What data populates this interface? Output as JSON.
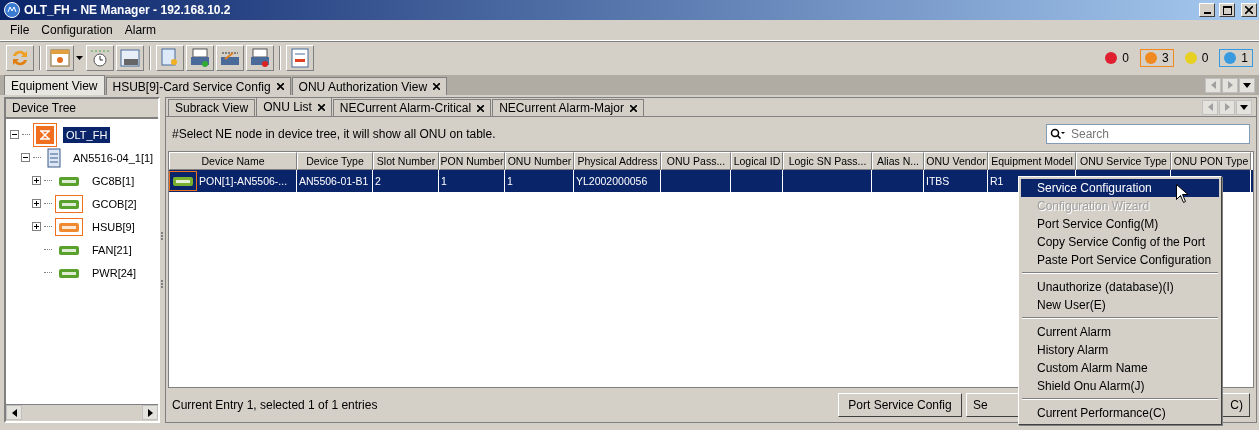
{
  "window": {
    "title": "OLT_FH - NE Manager - 192.168.10.2"
  },
  "menu_bar": [
    "File",
    "Configuration",
    "Alarm"
  ],
  "alarm_counters": [
    {
      "count": "0",
      "color": "#e02030",
      "selected": false
    },
    {
      "count": "3",
      "color": "#f08a20",
      "selected": true
    },
    {
      "count": "0",
      "color": "#e8d020",
      "selected": false
    },
    {
      "count": "1",
      "color": "#3a9ae0",
      "selected": true
    }
  ],
  "tabs": [
    {
      "label": "Equipment View",
      "selected": true,
      "closable": false
    },
    {
      "label": "HSUB[9]-Card Service Config",
      "selected": false,
      "closable": true
    },
    {
      "label": "ONU Authorization View",
      "selected": false,
      "closable": true
    }
  ],
  "device_tree": {
    "title": "Device Tree",
    "items": [
      {
        "label": "OLT_FH",
        "kind": "olt",
        "selected": true,
        "flagged": true,
        "expanded": true,
        "children": [
          {
            "label": "AN5516-04_1[1]",
            "kind": "rack",
            "selected": false,
            "flagged": false,
            "expanded": true,
            "children": [
              {
                "label": "GC8B[1]",
                "kind": "card",
                "color": "#5aa02c",
                "selected": false,
                "flagged": false,
                "expanded": false
              },
              {
                "label": "GCOB[2]",
                "kind": "card",
                "color": "#5aa02c",
                "selected": false,
                "flagged": true,
                "expanded": false
              },
              {
                "label": "HSUB[9]",
                "kind": "card",
                "color": "#f08a30",
                "selected": false,
                "flagged": true,
                "expanded": false
              },
              {
                "label": "FAN[21]",
                "kind": "card",
                "color": "#5aa02c",
                "selected": false,
                "flagged": false
              },
              {
                "label": "PWR[24]",
                "kind": "card",
                "color": "#5aa02c",
                "selected": false,
                "flagged": false
              }
            ]
          }
        ]
      }
    ]
  },
  "inner_tabs": [
    {
      "label": "Subrack View",
      "selected": false,
      "closable": false
    },
    {
      "label": "ONU List",
      "selected": true,
      "closable": true
    },
    {
      "label": "NECurrent Alarm-Critical",
      "selected": false,
      "closable": true
    },
    {
      "label": "NECurrent Alarm-Major",
      "selected": false,
      "closable": true
    }
  ],
  "hint": "#Select NE node in device tree, it will show all ONU on table.",
  "search": {
    "placeholder": "Search"
  },
  "table": {
    "columns": [
      "Device Name",
      "Device Type",
      "Slot Number",
      "PON Number",
      "ONU Number",
      "Physical Address",
      "ONU Pass...",
      "Logical ID",
      "Logic SN Pass...",
      "Alias N...",
      "ONU Vendor",
      "Equipment Model",
      "ONU Service Type",
      "ONU PON Type"
    ],
    "rows": [
      {
        "selected": true,
        "flagged": true,
        "cells": [
          "PON[1]-AN5506-...",
          "AN5506-01-B1",
          "2",
          "1",
          "1",
          "YL2002000056",
          "",
          "",
          "",
          "",
          "ITBS",
          "R1",
          "",
          ""
        ]
      }
    ]
  },
  "status": "Current Entry 1, selected 1 of 1 entries",
  "buttons": [
    "Port Service Config",
    "Se",
    "C)"
  ],
  "context_menu": [
    {
      "kind": "item",
      "label": "Service Configuration",
      "selected": true,
      "disabled": false
    },
    {
      "kind": "item",
      "label": "Configuration Wizard",
      "selected": false,
      "disabled": true
    },
    {
      "kind": "item",
      "label": "Port Service Config(M)",
      "selected": false,
      "disabled": false
    },
    {
      "kind": "item",
      "label": "Copy Service Config of the Port",
      "selected": false,
      "disabled": false
    },
    {
      "kind": "item",
      "label": "Paste Port Service Configuration",
      "selected": false,
      "disabled": false
    },
    {
      "kind": "separator"
    },
    {
      "kind": "item",
      "label": "Unauthorize (database)(I)",
      "selected": false,
      "disabled": false
    },
    {
      "kind": "item",
      "label": "New User(E)",
      "selected": false,
      "disabled": false
    },
    {
      "kind": "separator"
    },
    {
      "kind": "item",
      "label": "Current Alarm",
      "selected": false,
      "disabled": false
    },
    {
      "kind": "item",
      "label": "History Alarm",
      "selected": false,
      "disabled": false
    },
    {
      "kind": "item",
      "label": "Custom Alarm Name",
      "selected": false,
      "disabled": false
    },
    {
      "kind": "item",
      "label": "Shield Onu Alarm(J)",
      "selected": false,
      "disabled": false
    },
    {
      "kind": "separator"
    },
    {
      "kind": "item",
      "label": "Current Performance(C)",
      "selected": false,
      "disabled": false
    }
  ]
}
